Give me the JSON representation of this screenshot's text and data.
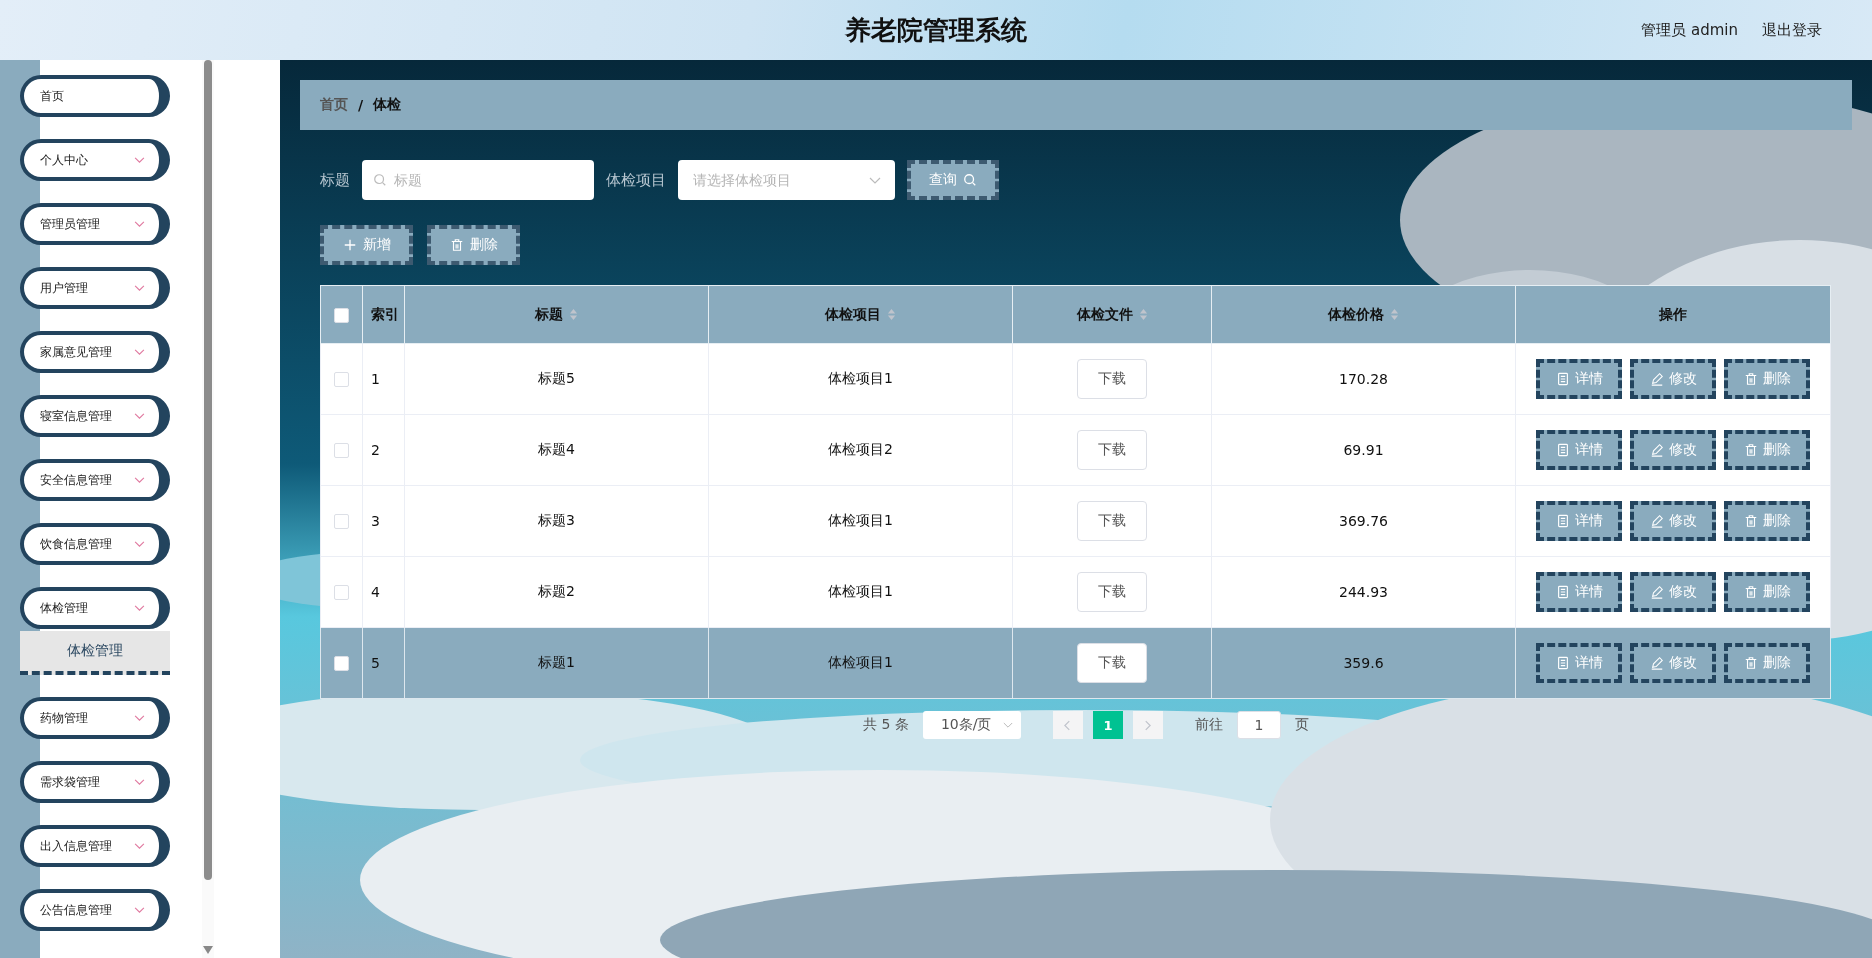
{
  "header": {
    "title": "养老院管理系统",
    "user": "管理员 admin",
    "logout": "退出登录"
  },
  "sidebar": {
    "items": [
      {
        "label": "首页",
        "kind": "link"
      },
      {
        "label": "个人中心",
        "kind": "submenu"
      },
      {
        "label": "管理员管理",
        "kind": "submenu"
      },
      {
        "label": "用户管理",
        "kind": "submenu"
      },
      {
        "label": "家属意见管理",
        "kind": "submenu"
      },
      {
        "label": "寝室信息管理",
        "kind": "submenu"
      },
      {
        "label": "安全信息管理",
        "kind": "submenu"
      },
      {
        "label": "饮食信息管理",
        "kind": "submenu"
      },
      {
        "label": "体检管理",
        "kind": "submenu",
        "children": [
          {
            "label": "体检管理",
            "selected": true
          }
        ]
      },
      {
        "label": "药物管理",
        "kind": "submenu"
      },
      {
        "label": "需求袋管理",
        "kind": "submenu"
      },
      {
        "label": "出入信息管理",
        "kind": "submenu"
      },
      {
        "label": "公告信息管理",
        "kind": "submenu"
      }
    ]
  },
  "breadcrumb": {
    "items": [
      "首页",
      "体检"
    ],
    "separator": "/"
  },
  "search": {
    "title_label": "标题",
    "title_placeholder": "标题",
    "item_label": "体检项目",
    "item_placeholder": "请选择体检项目",
    "query_button": "查询"
  },
  "toolbar": [
    {
      "label": "新增",
      "kind": "add"
    },
    {
      "label": "删除",
      "kind": "delete"
    }
  ],
  "table": {
    "select_all_checked": false,
    "columns": [
      {
        "label": "索引",
        "sortable": false
      },
      {
        "label": "标题",
        "sortable": true
      },
      {
        "label": "体检项目",
        "sortable": true
      },
      {
        "label": "体检文件",
        "sortable": true
      },
      {
        "label": "体检价格",
        "sortable": true
      },
      {
        "label": "操作",
        "sortable": false
      }
    ],
    "rows": [
      {
        "checked": false,
        "highlighted": false,
        "index": "1",
        "title": "标题5",
        "item": "体检项目1",
        "file": "下载",
        "price": "170.28",
        "actions": [
          {
            "label": "详情",
            "kind": "detail"
          },
          {
            "label": "修改",
            "kind": "edit"
          },
          {
            "label": "删除",
            "kind": "delete"
          }
        ]
      },
      {
        "checked": false,
        "highlighted": false,
        "index": "2",
        "title": "标题4",
        "item": "体检项目2",
        "file": "下载",
        "price": "69.91",
        "actions": [
          {
            "label": "详情",
            "kind": "detail"
          },
          {
            "label": "修改",
            "kind": "edit"
          },
          {
            "label": "删除",
            "kind": "delete"
          }
        ]
      },
      {
        "checked": false,
        "highlighted": false,
        "index": "3",
        "title": "标题3",
        "item": "体检项目1",
        "file": "下载",
        "price": "369.76",
        "actions": [
          {
            "label": "详情",
            "kind": "detail"
          },
          {
            "label": "修改",
            "kind": "edit"
          },
          {
            "label": "删除",
            "kind": "delete"
          }
        ]
      },
      {
        "checked": false,
        "highlighted": false,
        "index": "4",
        "title": "标题2",
        "item": "体检项目1",
        "file": "下载",
        "price": "244.93",
        "actions": [
          {
            "label": "详情",
            "kind": "detail"
          },
          {
            "label": "修改",
            "kind": "edit"
          },
          {
            "label": "删除",
            "kind": "delete"
          }
        ]
      },
      {
        "checked": false,
        "highlighted": true,
        "index": "5",
        "title": "标题1",
        "item": "体检项目1",
        "file": "下载",
        "price": "359.6",
        "actions": [
          {
            "label": "详情",
            "kind": "detail"
          },
          {
            "label": "修改",
            "kind": "edit"
          },
          {
            "label": "删除",
            "kind": "delete"
          }
        ]
      }
    ]
  },
  "pagination": {
    "total": "共 5 条",
    "page_size": "10条/页",
    "pages": [
      {
        "label": "1",
        "selected": true
      }
    ],
    "goto_label": "前往",
    "goto_value": "1",
    "goto_suffix": "页"
  }
}
